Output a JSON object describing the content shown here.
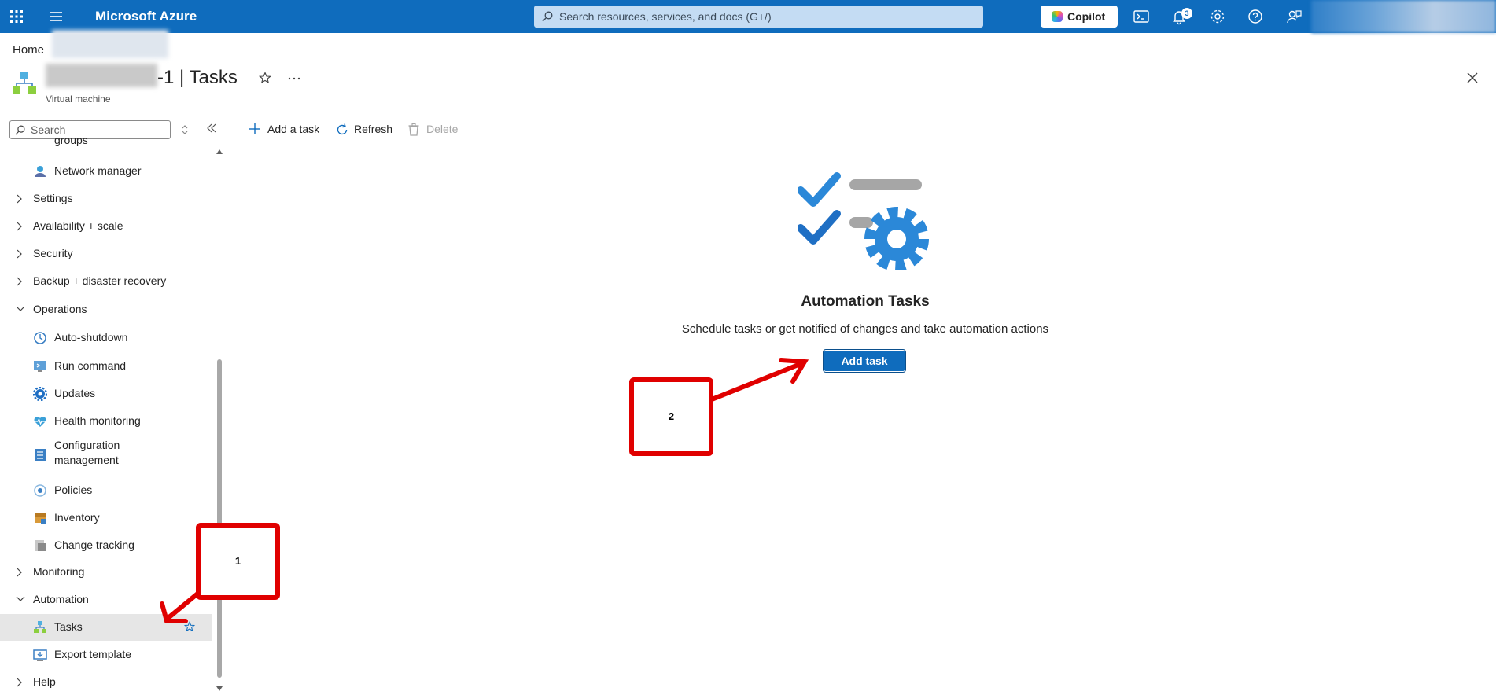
{
  "topbar": {
    "brand": "Microsoft Azure",
    "search_placeholder": "Search resources, services, and docs (G+/)",
    "copilot_label": "Copilot",
    "notification_count": "3",
    "bg_color": "#0f6cbd"
  },
  "breadcrumb": {
    "home": "Home"
  },
  "header": {
    "title_suffix": "-1 | Tasks",
    "subtitle": "Virtual machine"
  },
  "sidebar": {
    "search_placeholder": "Search",
    "partial_item": "groups",
    "items": [
      {
        "label": "Network manager",
        "type": "child",
        "icon": "network-manager-icon"
      },
      {
        "label": "Settings",
        "type": "group",
        "expanded": false
      },
      {
        "label": "Availability + scale",
        "type": "group",
        "expanded": false
      },
      {
        "label": "Security",
        "type": "group",
        "expanded": false
      },
      {
        "label": "Backup + disaster recovery",
        "type": "group",
        "expanded": false
      },
      {
        "label": "Operations",
        "type": "group",
        "expanded": true
      },
      {
        "label": "Auto-shutdown",
        "type": "child",
        "icon": "clock-icon"
      },
      {
        "label": "Run command",
        "type": "child",
        "icon": "run-command-icon"
      },
      {
        "label": "Updates",
        "type": "child",
        "icon": "gear-icon"
      },
      {
        "label": "Health monitoring",
        "type": "child",
        "icon": "heart-icon"
      },
      {
        "label": "Configuration",
        "label2": "management",
        "type": "child",
        "icon": "config-icon"
      },
      {
        "label": "Policies",
        "type": "child",
        "icon": "policy-icon"
      },
      {
        "label": "Inventory",
        "type": "child",
        "icon": "inventory-icon"
      },
      {
        "label": "Change tracking",
        "type": "child",
        "icon": "change-tracking-icon"
      },
      {
        "label": "Monitoring",
        "type": "group",
        "expanded": false
      },
      {
        "label": "Automation",
        "type": "group",
        "expanded": true
      },
      {
        "label": "Tasks",
        "type": "child",
        "icon": "tasks-icon",
        "selected": true
      },
      {
        "label": "Export template",
        "type": "child",
        "icon": "export-icon"
      },
      {
        "label": "Help",
        "type": "group",
        "expanded": false
      }
    ]
  },
  "toolbar": {
    "add_label": "Add a task",
    "refresh_label": "Refresh",
    "delete_label": "Delete"
  },
  "empty_state": {
    "title": "Automation Tasks",
    "description": "Schedule tasks or get notified of changes and take automation actions",
    "button_label": "Add task"
  },
  "annotations": {
    "callout1": "1",
    "callout2": "2",
    "color": "#e00000"
  }
}
